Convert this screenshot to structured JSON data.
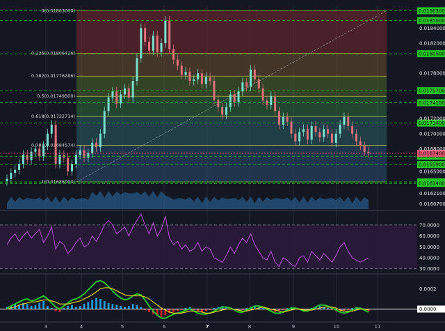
{
  "chart_data": [
    {
      "type": "candlestick",
      "x_ticks": [
        "3",
        "4",
        "5",
        "6",
        "7",
        "8",
        "9",
        "10",
        "11"
      ],
      "x_ticks_bold": [
        "7"
      ],
      "y_ticks": [
        "0.01840000",
        "0.01820000",
        "0.01780000",
        "0.01720000",
        "0.01700000",
        "0.01680000",
        "0.01650000",
        "0.01621000",
        "0.01607000"
      ],
      "ylim": [
        0.016,
        0.01868
      ],
      "fibonacci": {
        "levels": [
          {
            "label": "0(0.01863000)",
            "value": 0.01863,
            "fill": "#7a2a2f"
          },
          {
            "label": "0.236(0.01806426)",
            "value": 0.018064,
            "fill": "#6b4f2b"
          },
          {
            "label": "0.382(0.01776286)",
            "value": 0.017763,
            "fill": "#4f6a2a"
          },
          {
            "label": "0.5(0.01749500)",
            "value": 0.017495,
            "fill": "#2f6b3a"
          },
          {
            "label": "0.618(0.01722714)",
            "value": 0.017227,
            "fill": "#2a5f63"
          },
          {
            "label": "0.786(0.01684574)",
            "value": 0.016846,
            "fill": "#2a4f6f"
          },
          {
            "label": "1(0.01636000)",
            "value": 0.01636,
            "fill": "#3b4150"
          }
        ],
        "line_color": "#d8d84a"
      },
      "horizontal_levels": [
        {
          "label": "0.01863000",
          "value": 0.01863
        },
        {
          "label": "0.01850000",
          "value": 0.0185
        },
        {
          "label": "0.01806000",
          "value": 0.01806
        },
        {
          "label": "0.01757000",
          "value": 0.01757
        },
        {
          "label": "0.01741000",
          "value": 0.01741
        },
        {
          "label": "0.01714000",
          "value": 0.01714
        },
        {
          "label": "0.01670000",
          "value": 0.0167
        },
        {
          "label": "0.01659000",
          "value": 0.01659
        },
        {
          "label": "0.01636000",
          "value": 0.01636
        },
        {
          "label": "0.01634000",
          "value": 0.01634
        }
      ],
      "last_price": {
        "label": "0.01674000",
        "value": 0.01674,
        "color": "#e8536f"
      },
      "level_color": "#22c522",
      "candles_close": [
        0.0164,
        0.01648,
        0.01652,
        0.0166,
        0.01672,
        0.01665,
        0.01676,
        0.0168,
        0.0167,
        0.01684,
        0.017,
        0.01712,
        0.0166,
        0.01672,
        0.01668,
        0.0165,
        0.0166,
        0.01672,
        0.01678,
        0.01668,
        0.01674,
        0.01688,
        0.01682,
        0.017,
        0.0173,
        0.01748,
        0.01756,
        0.0174,
        0.01752,
        0.0176,
        0.01748,
        0.0177,
        0.018,
        0.0184,
        0.01822,
        0.0181,
        0.0183,
        0.01808,
        0.0182,
        0.0185,
        0.01812,
        0.01798,
        0.0179,
        0.01778,
        0.01782,
        0.0177,
        0.01772,
        0.0178,
        0.01766,
        0.01775,
        0.0177,
        0.01745,
        0.01735,
        0.01725,
        0.01735,
        0.01752,
        0.01742,
        0.01756,
        0.01768,
        0.01762,
        0.01785,
        0.01772,
        0.0176,
        0.01744,
        0.01738,
        0.0175,
        0.0173,
        0.01712,
        0.01722,
        0.01716,
        0.017,
        0.0169,
        0.01702,
        0.01706,
        0.01692,
        0.0171,
        0.01702,
        0.01695,
        0.01706,
        0.017,
        0.01688,
        0.017,
        0.01712,
        0.01722,
        0.0171,
        0.017,
        0.0169,
        0.01684,
        0.01676,
        0.01674
      ]
    },
    {
      "type": "line",
      "name_hidden": true,
      "y_ticks": [
        "70.0000",
        "60.0000",
        "50.0000",
        "40.0000",
        "30.0000"
      ],
      "ylim": [
        26,
        82
      ],
      "upper_band": 70,
      "lower_band": 30,
      "values": [
        52,
        58,
        62,
        55,
        60,
        64,
        58,
        62,
        66,
        54,
        60,
        68,
        48,
        55,
        52,
        44,
        48,
        54,
        58,
        50,
        52,
        60,
        55,
        62,
        70,
        74,
        70,
        62,
        65,
        68,
        60,
        68,
        74,
        80,
        70,
        62,
        72,
        60,
        66,
        78,
        58,
        52,
        55,
        48,
        52,
        46,
        48,
        54,
        46,
        50,
        48,
        40,
        38,
        36,
        42,
        50,
        44,
        52,
        58,
        54,
        62,
        52,
        46,
        40,
        38,
        46,
        36,
        32,
        40,
        38,
        34,
        32,
        40,
        42,
        36,
        46,
        42,
        38,
        44,
        40,
        36,
        42,
        50,
        54,
        46,
        40,
        38,
        36,
        38,
        40
      ],
      "line_color": "#b84fd8"
    },
    {
      "type": "bar",
      "y_ticks": [
        "0.0002",
        "0.0000"
      ],
      "ylim": [
        -0.00012,
        0.00034
      ],
      "histogram": [
        2e-05,
        3e-05,
        5e-05,
        4e-05,
        6e-05,
        5e-05,
        3e-05,
        4e-05,
        6e-05,
        8e-05,
        3e-05,
        1e-05,
        -2e-05,
        -3e-05,
        1e-05,
        3e-05,
        4e-05,
        2e-05,
        3e-05,
        5e-05,
        7e-05,
        9e-05,
        0.00011,
        0.0001,
        8e-05,
        6e-05,
        5e-05,
        4e-05,
        3e-05,
        2e-05,
        3e-05,
        5e-05,
        4e-05,
        2e-05,
        -1e-05,
        -3e-05,
        -5e-05,
        -7e-05,
        -8e-05,
        -6e-05,
        -4e-05,
        -3e-05,
        -2e-05,
        -1e-05,
        1e-05,
        2e-05,
        -1e-05,
        -2e-05,
        -3e-05,
        -2e-05,
        -1e-05,
        1e-05,
        2e-05,
        3e-05,
        2e-05,
        1e-05,
        -1e-05,
        -2e-05,
        -1e-05,
        1e-05,
        2e-05,
        3e-05,
        2e-05,
        1e-05,
        -1e-05,
        -2e-05,
        -3e-05,
        -2e-05,
        -1e-05,
        1e-05,
        2e-05,
        1e-05,
        -1e-05,
        -2e-05,
        -1e-05,
        1e-05,
        2e-05,
        3e-05,
        2e-05,
        1e-05,
        -1e-05,
        -2e-05,
        -3e-05,
        -2e-05,
        -1e-05,
        1e-05,
        2e-05,
        1e-05,
        -1e-05,
        -2e-05
      ],
      "macd": [
        1e-05,
        3e-05,
        5e-05,
        7e-05,
        9e-05,
        0.0001,
        8e-05,
        9e-05,
        0.00011,
        0.00013,
        0.0001,
        6e-05,
        2e-05,
        0.0,
        3e-05,
        6e-05,
        9e-05,
        0.0001,
        0.00012,
        0.00015,
        0.00019,
        0.00023,
        0.00027,
        0.00028,
        0.00026,
        0.00022,
        0.00018,
        0.00014,
        0.00011,
        9e-05,
        0.0001,
        0.00013,
        0.00015,
        0.00014,
        9e-05,
        3e-05,
        -2e-05,
        -6e-05,
        -9e-05,
        -9e-05,
        -7e-05,
        -5e-05,
        -4e-05,
        -3e-05,
        -1e-05,
        0.0,
        -2e-05,
        -4e-05,
        -5e-05,
        -5e-05,
        -4e-05,
        -2e-05,
        0.0,
        2e-05,
        2e-05,
        1e-05,
        -1e-05,
        -3e-05,
        -3e-05,
        -1e-05,
        1e-05,
        3e-05,
        3e-05,
        2e-05,
        0.0,
        -2e-05,
        -4e-05,
        -4e-05,
        -3e-05,
        -1e-05,
        1e-05,
        1e-05,
        0.0,
        -2e-05,
        -2e-05,
        0.0,
        2e-05,
        4e-05,
        4e-05,
        3e-05,
        1e-05,
        -1e-05,
        -3e-05,
        -4e-05,
        -3e-05,
        -1e-05,
        1e-05,
        1e-05,
        -1e-05,
        -3e-05
      ],
      "signal": [
        0.0,
        1e-05,
        2e-05,
        4e-05,
        5e-05,
        6e-05,
        7e-05,
        7e-05,
        8e-05,
        9e-05,
        9e-05,
        8e-05,
        7e-05,
        5e-05,
        5e-05,
        5e-05,
        6e-05,
        7e-05,
        8e-05,
        0.0001,
        0.00012,
        0.00014,
        0.00017,
        0.0002,
        0.00021,
        0.00021,
        0.0002,
        0.00018,
        0.00016,
        0.00014,
        0.00013,
        0.00013,
        0.00013,
        0.00013,
        0.00012,
        0.0001,
        7e-05,
        4e-05,
        1e-05,
        -1e-05,
        -3e-05,
        -4e-05,
        -4e-05,
        -4e-05,
        -3e-05,
        -2e-05,
        -2e-05,
        -2e-05,
        -3e-05,
        -4e-05,
        -4e-05,
        -3e-05,
        -2e-05,
        -1e-05,
        0.0,
        0.0,
        0.0,
        -1e-05,
        -2e-05,
        -2e-05,
        -1e-05,
        0.0,
        1e-05,
        2e-05,
        1e-05,
        0.0,
        -1e-05,
        -2e-05,
        -3e-05,
        -2e-05,
        -1e-05,
        0.0,
        0.0,
        -1e-05,
        -1e-05,
        -1e-05,
        0.0,
        1e-05,
        2e-05,
        2e-05,
        2e-05,
        1e-05,
        -1e-05,
        -2e-05,
        -2e-05,
        -2e-05,
        -1e-05,
        0.0,
        0.0,
        -1e-05
      ],
      "macd_color": "#27c227",
      "signal_color": "#e0d020",
      "zero_line_color": "#ffffff"
    }
  ],
  "colors": {
    "background": "#131722",
    "grid": "#262b38",
    "up": "#7ae0d0",
    "down": "#e0707a",
    "volume_area": "#2e6ea8",
    "rsi_band_fill": "#2a1a3a"
  }
}
